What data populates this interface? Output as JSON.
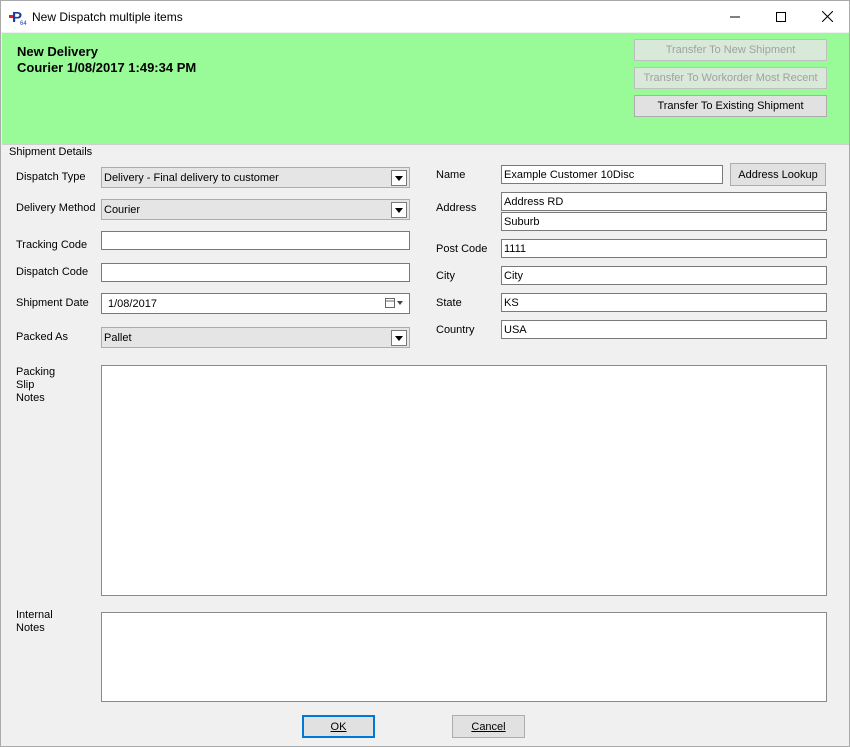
{
  "window": {
    "title": "New Dispatch multiple items",
    "app_icon": "p-app-icon"
  },
  "banner": {
    "title": "New Delivery",
    "subtitle": "Courier 1/08/2017 1:49:34 PM",
    "color": "#98fb98",
    "buttons": {
      "new_shipment": "Transfer To New Shipment",
      "workorder_recent": "Transfer To Workorder Most Recent",
      "existing_shipment": "Transfer To Existing Shipment"
    }
  },
  "shipment": {
    "group_label": "Shipment Details",
    "dispatch_type": {
      "label": "Dispatch Type",
      "value": "Delivery - Final delivery to customer"
    },
    "delivery_method": {
      "label": "Delivery Method",
      "value": "Courier"
    },
    "tracking_code": {
      "label": "Tracking Code",
      "value": ""
    },
    "dispatch_code": {
      "label": "Dispatch Code",
      "value": ""
    },
    "shipment_date": {
      "label": "Shipment Date",
      "value": "1/08/2017"
    },
    "packed_as": {
      "label": "Packed As",
      "value": "Pallet"
    },
    "packing_slip_notes": {
      "label_lines": [
        "Packing",
        "Slip",
        "Notes"
      ],
      "value": ""
    },
    "internal_notes": {
      "label_lines": [
        "Internal",
        "Notes"
      ],
      "value": ""
    }
  },
  "address": {
    "name": {
      "label": "Name",
      "value": "Example Customer 10Disc"
    },
    "lookup_button": "Address Lookup",
    "address": {
      "label": "Address",
      "line1": "Address RD",
      "line2": "Suburb"
    },
    "post_code": {
      "label": "Post Code",
      "value": "1111"
    },
    "city": {
      "label": "City",
      "value": "City"
    },
    "state": {
      "label": "State",
      "value": "KS"
    },
    "country": {
      "label": "Country",
      "value": "USA"
    }
  },
  "footer": {
    "ok": "OK",
    "cancel": "Cancel"
  }
}
